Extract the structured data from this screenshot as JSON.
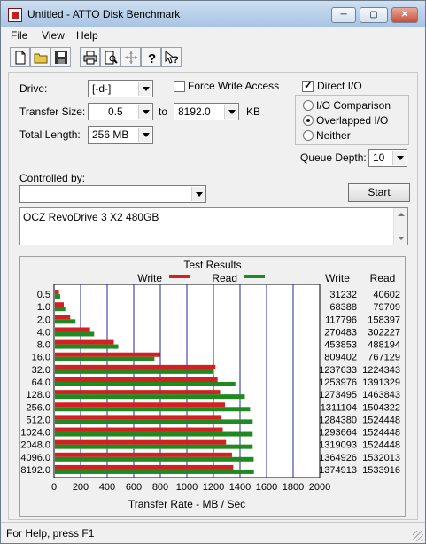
{
  "window": {
    "title": "Untitled - ATTO Disk Benchmark",
    "min_label": "─",
    "max_label": "▢",
    "close_label": "✕"
  },
  "menu": [
    "File",
    "View",
    "Help"
  ],
  "toolbar_icons": [
    "new-file-icon",
    "open-folder-icon",
    "save-icon",
    "print-icon",
    "print-preview-icon",
    "move-icon",
    "help-icon",
    "context-help-icon"
  ],
  "settings": {
    "drive_label": "Drive:",
    "drive_value": "[-d-]",
    "transfer_size_label": "Transfer Size:",
    "transfer_from": "0.5",
    "to_label": "to",
    "transfer_to": "8192.0",
    "kb_label": "KB",
    "total_length_label": "Total Length:",
    "total_length_value": "256 MB",
    "force_write_label": "Force Write Access",
    "force_write_checked": false,
    "direct_io_label": "Direct I/O",
    "direct_io_checked": true,
    "io_comparison_label": "I/O Comparison",
    "overlapped_io_label": "Overlapped I/O",
    "neither_label": "Neither",
    "selected_mode": "overlapped",
    "queue_depth_label": "Queue Depth:",
    "queue_depth_value": "10",
    "controlled_by_label": "Controlled by:",
    "controlled_by_value": "",
    "start_label": "Start",
    "description": "OCZ RevoDrive 3 X2 480GB"
  },
  "results": {
    "title": "Test Results",
    "write_legend": "Write",
    "read_legend": "Read",
    "write_col": "Write",
    "read_col": "Read",
    "x_axis_label": "Transfer Rate - MB / Sec",
    "write_color": "#d42020",
    "read_color": "#208a20"
  },
  "chart_data": {
    "type": "bar",
    "orientation": "horizontal",
    "title": "Test Results",
    "xlabel": "Transfer Rate - MB / Sec",
    "xlim": [
      0,
      2000
    ],
    "x_ticks": [
      "0",
      "200",
      "400",
      "600",
      "800",
      "1000",
      "1200",
      "1400",
      "1600",
      "1800",
      "2000"
    ],
    "categories": [
      "0.5",
      "1.0",
      "2.0",
      "4.0",
      "8.0",
      "16.0",
      "32.0",
      "64.0",
      "128.0",
      "256.0",
      "512.0",
      "1024.0",
      "2048.0",
      "4096.0",
      "8192.0"
    ],
    "series": [
      {
        "name": "Write",
        "values_kb": [
          31232,
          68388,
          117796,
          270483,
          453853,
          809402,
          1237633,
          1253976,
          1273495,
          1311104,
          1284380,
          1293664,
          1319093,
          1364926,
          1374913
        ]
      },
      {
        "name": "Read",
        "values_kb": [
          40602,
          79709,
          158397,
          302227,
          488194,
          767129,
          1224343,
          1391329,
          1463843,
          1504322,
          1524448,
          1524448,
          1524448,
          1532013,
          1533916
        ]
      }
    ],
    "grid": true,
    "legend": "top"
  },
  "status": {
    "text": "For Help, press F1"
  }
}
